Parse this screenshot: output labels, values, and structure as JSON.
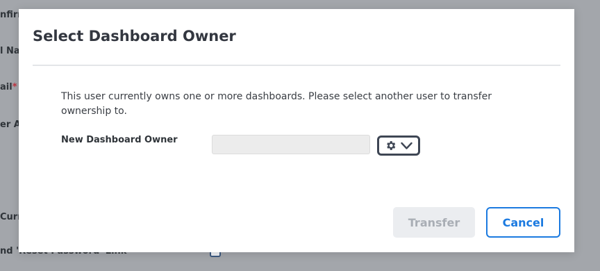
{
  "background_form": {
    "labels": [
      "nfirm",
      "l Nam",
      "ail",
      "er Ac",
      "Curre",
      "nd 'Reset Password' Link"
    ],
    "required_marker": "*"
  },
  "dialog": {
    "title": "Select Dashboard Owner",
    "message": "This user currently owns one or more dashboards. Please select another user to transfer ownership to.",
    "field": {
      "label": "New Dashboard Owner",
      "value": "",
      "options_icons": [
        "gear-icon",
        "chevron-down-icon"
      ]
    },
    "buttons": {
      "transfer": "Transfer",
      "cancel": "Cancel"
    }
  },
  "colors": {
    "backdrop": "#a3a6ab",
    "accent": "#1b7ae0",
    "disabled_text": "#a9aeb5",
    "required": "#c0333f"
  }
}
